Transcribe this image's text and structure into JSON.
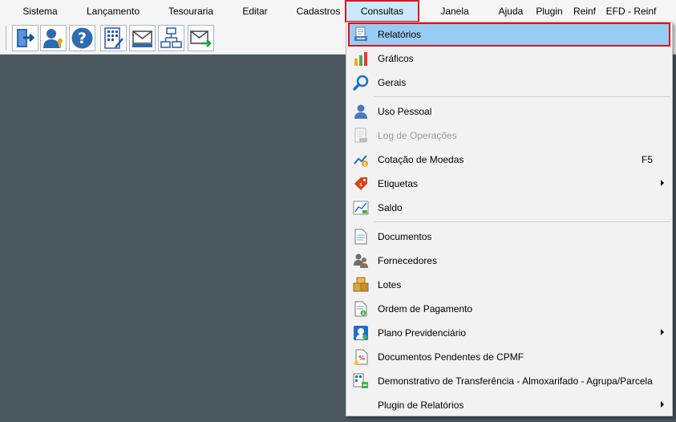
{
  "menubar": {
    "items": [
      "Sistema",
      "Lançamento",
      "Tesouraria",
      "Editar",
      "Cadastros",
      "Consultas",
      "Janela",
      "Ajuda",
      "Plugin",
      "Reinf",
      "EFD - Reinf"
    ],
    "active": "Consultas"
  },
  "toolbar": {
    "buttons": [
      {
        "icon": "exit-door-icon"
      },
      {
        "icon": "user-key-icon"
      },
      {
        "icon": "help-question-icon"
      },
      {
        "icon": "calculator-sheet-icon"
      },
      {
        "icon": "mail-tray-icon"
      },
      {
        "icon": "org-chart-icon"
      },
      {
        "icon": "mail-forward-icon"
      }
    ]
  },
  "consultas_menu": {
    "items": [
      {
        "label": "Relatórios",
        "icon": "report-printer-icon",
        "selected": true
      },
      {
        "label": "Gráficos",
        "icon": "bar-chart-icon"
      },
      {
        "label": "Gerais",
        "icon": "magnifier-icon"
      },
      {
        "label": "Uso Pessoal",
        "icon": "person-icon"
      },
      {
        "label": "Log de Operações",
        "icon": "log-document-icon",
        "disabled": true
      },
      {
        "label": "Cotação de Moedas",
        "icon": "currency-chart-icon",
        "shortcut": "F5"
      },
      {
        "label": "Etiquetas",
        "icon": "price-tag-icon",
        "submenu": true
      },
      {
        "label": "Saldo",
        "icon": "balance-chart-icon"
      },
      {
        "label": "Documentos",
        "icon": "document-icon"
      },
      {
        "label": "Fornecedores",
        "icon": "suppliers-icon"
      },
      {
        "label": "Lotes",
        "icon": "boxes-icon"
      },
      {
        "label": "Ordem de Pagamento",
        "icon": "payment-order-icon"
      },
      {
        "label": "Plano Previdenciário",
        "icon": "pension-plan-icon",
        "submenu": true
      },
      {
        "label": "Documentos Pendentes de CPMF",
        "icon": "pending-document-icon"
      },
      {
        "label": "Demonstrativo de Transferência - Almoxarifado - Agrupa/Parcela",
        "icon": "transfer-report-icon"
      },
      {
        "label": "Plugin de Relatórios",
        "icon": "blank-icon",
        "submenu": true
      }
    ]
  },
  "colors": {
    "desktop": "#4a575e",
    "menu_background": "#f2f2f2",
    "selection": "#99ccf5",
    "highlight_border": "#d9141c"
  }
}
